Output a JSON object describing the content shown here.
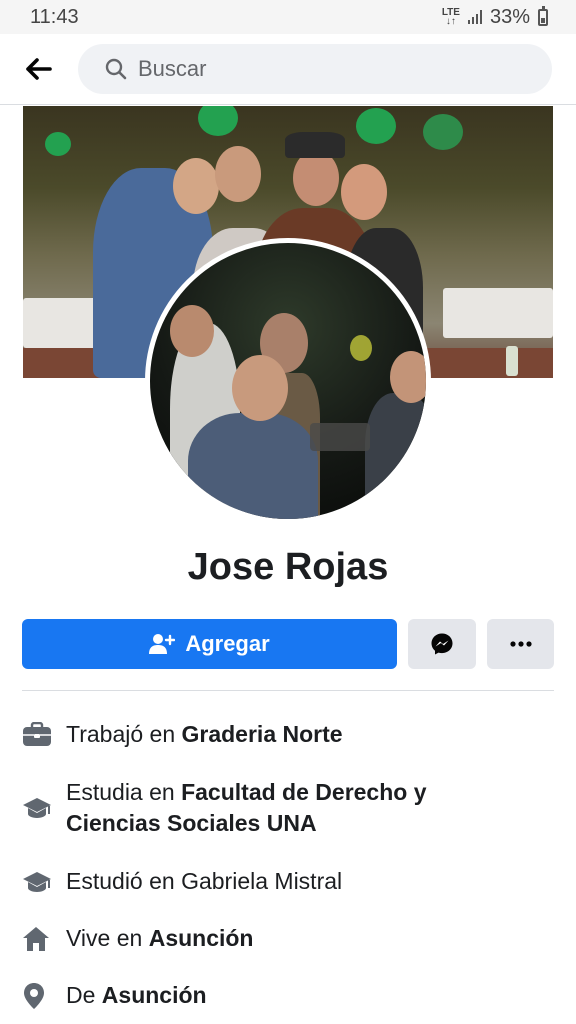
{
  "status_bar": {
    "time": "11:43",
    "network": "LTE",
    "battery": "33%"
  },
  "header": {
    "search_placeholder": "Buscar",
    "back_icon": "back-arrow-icon",
    "search_icon": "search-icon"
  },
  "profile": {
    "name": "Jose Rojas",
    "add_label": "Agregar",
    "add_icon": "add-friend-icon",
    "messenger_icon": "messenger-icon",
    "more_icon": "more-icon"
  },
  "details": [
    {
      "icon": "briefcase-icon",
      "prefix": "Trabajó en ",
      "value": "Graderia Norte"
    },
    {
      "icon": "graduation-cap-icon",
      "prefix": "Estudia en ",
      "value": "Facultad de Derecho y",
      "value2": "Ciencias Sociales UNA"
    },
    {
      "icon": "graduation-cap-icon",
      "prefix": "Estudió en Gabriela Mistral",
      "value": ""
    },
    {
      "icon": "home-icon",
      "prefix": "Vive en ",
      "value": "Asunción"
    },
    {
      "icon": "location-pin-icon",
      "prefix": "De ",
      "value": "Asunción"
    }
  ],
  "colors": {
    "accent": "#1877f2",
    "secondary_button": "#e4e6eb",
    "icon_grey": "#606770"
  }
}
